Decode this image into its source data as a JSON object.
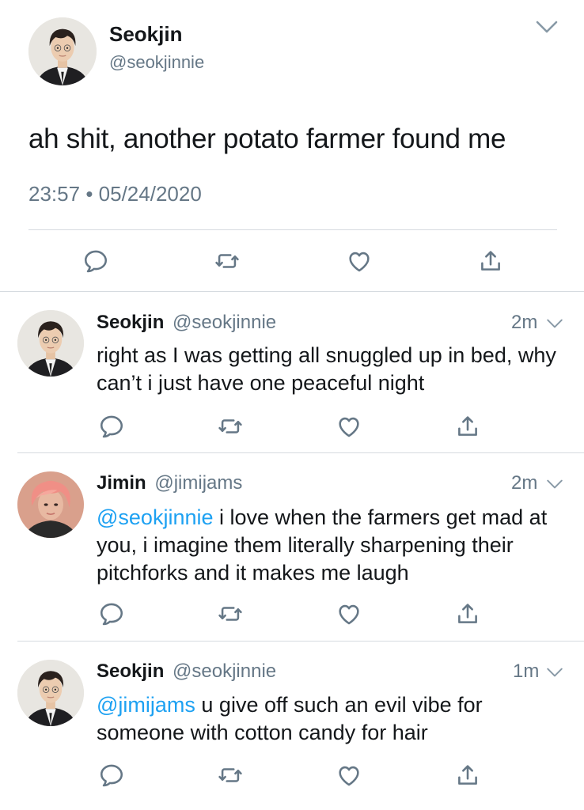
{
  "main_tweet": {
    "name": "Seokjin",
    "handle": "@seokjinnie",
    "text": "ah shit, another potato farmer found me",
    "time": "23:57",
    "separator": "•",
    "date": "05/24/2020"
  },
  "replies": [
    {
      "name": "Seokjin",
      "handle": "@seokjinnie",
      "time": "2m",
      "mention": "",
      "text": "right as I was getting all snuggled up in bed, why can’t i just have one peaceful night"
    },
    {
      "name": "Jimin",
      "handle": "@jimijams",
      "time": "2m",
      "mention": "@seokjinnie",
      "text": " i love when the farmers get mad at you, i imagine them literally sharpening their pitchforks and it makes me laugh"
    },
    {
      "name": "Seokjin",
      "handle": "@seokjinnie",
      "time": "1m",
      "mention": "@jimijams",
      "text": " u give off such an evil vibe for someone with cotton candy for hair"
    }
  ],
  "icons": {
    "reply": "reply-icon",
    "retweet": "retweet-icon",
    "like": "heart-icon",
    "share": "share-icon",
    "menu": "chevron-down-icon"
  },
  "colors": {
    "text": "#14171a",
    "secondary": "#657786",
    "mention": "#1da1f2",
    "divider": "#d6dbe0"
  }
}
